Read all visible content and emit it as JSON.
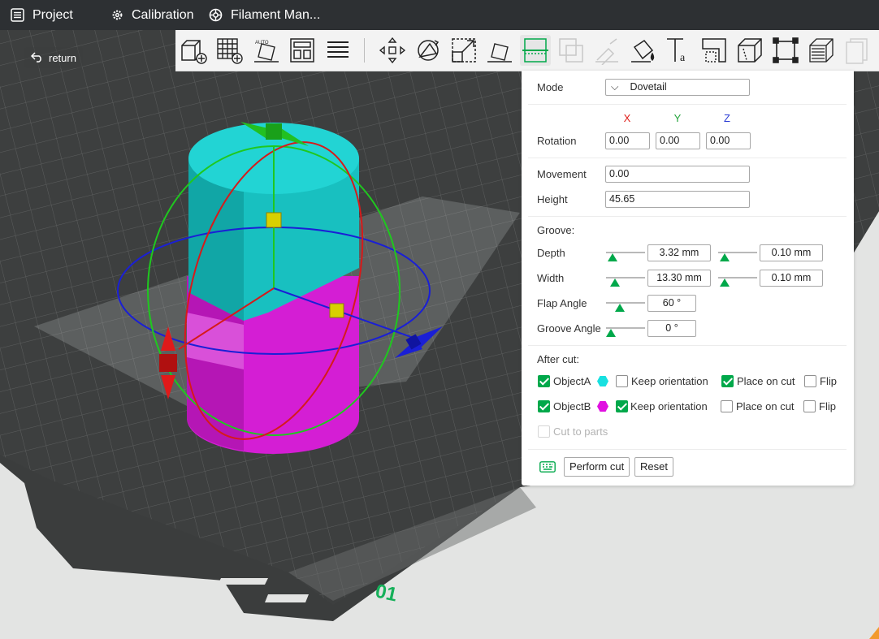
{
  "topbar": {
    "project": "Project",
    "calibration": "Calibration",
    "filament": "Filament Man..."
  },
  "viewport": {
    "return_label": "return",
    "plate_number": "01"
  },
  "toolbar": {
    "tools": [
      "add-object-icon",
      "add-plate-icon",
      "auto-orient-icon",
      "arrange-icon",
      "layers-icon",
      "move-icon",
      "rotate-icon",
      "scale-icon",
      "lay-on-face-icon",
      "cut-icon",
      "mesh-boolean-icon",
      "support-paint-icon",
      "color-paint-icon",
      "text-icon",
      "emboss-icon",
      "measure-icon",
      "assembly-icon",
      "fuzzy-skin-icon",
      "variable-layer-icon"
    ]
  },
  "cut": {
    "mode_label": "Mode",
    "mode_value": "Dovetail",
    "axes": {
      "x": "X",
      "y": "Y",
      "z": "Z"
    },
    "axis_colors": {
      "x": "#e0201c",
      "y": "#22a43a",
      "z": "#2a3bd4"
    },
    "rotation_label": "Rotation",
    "rotation": {
      "x": "0.00",
      "y": "0.00",
      "z": "0.00"
    },
    "movement_label": "Movement",
    "movement_value": "0.00",
    "height_label": "Height",
    "height_value": "45.65",
    "groove_label": "Groove:",
    "depth_label": "Depth",
    "depth_value": "3.32  mm",
    "depth_fraction": 0.05,
    "depth_tol_value": "0.10  mm",
    "depth_tol_fraction": 0.05,
    "width_label": "Width",
    "width_value": "13.30  mm",
    "width_fraction": 0.15,
    "width_tol_value": "0.10  mm",
    "width_tol_fraction": 0.05,
    "flap_label": "Flap Angle",
    "flap_value": "60 °",
    "flap_fraction": 0.3,
    "groove_angle_label": "Groove Angle",
    "groove_angle_value": "0 °",
    "groove_angle_fraction": 0.0,
    "after_cut_label": "After cut:",
    "objectA": {
      "label": "ObjectA",
      "color": "#18e0e0",
      "checked": true,
      "keep_orientation": false,
      "place_on_cut": true,
      "flip": false
    },
    "objectB": {
      "label": "ObjectB",
      "color": "#e010e0",
      "checked": true,
      "keep_orientation": true,
      "place_on_cut": false,
      "flip": false
    },
    "keep_orientation_label": "Keep orientation",
    "place_on_cut_label": "Place on cut",
    "flip_label": "Flip",
    "cut_to_parts_label": "Cut to parts",
    "perform_cut_label": "Perform cut",
    "reset_label": "Reset"
  }
}
